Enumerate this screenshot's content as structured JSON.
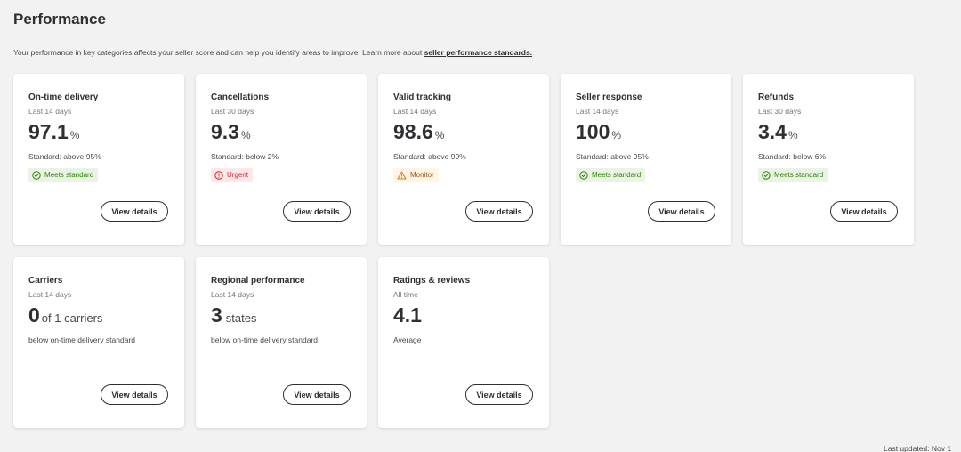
{
  "page": {
    "title": "Performance",
    "intro_text": "Your performance in key categories affects your seller score and can help you identify areas to improve. Learn more about ",
    "intro_link": "seller performance standards.",
    "last_updated": "Last updated: Nov 1"
  },
  "colors": {
    "good": "#2a8703",
    "urgent": "#de1c24",
    "monitor": "#995213"
  },
  "cards": [
    {
      "title": "On-time delivery",
      "period": "Last 14 days",
      "value": "97.1",
      "unit": "%",
      "standard": "Standard: above 95%",
      "badge": {
        "label": "Meets standard",
        "status": "good",
        "icon": "check-circle-icon"
      },
      "button": "View details"
    },
    {
      "title": "Cancellations",
      "period": "Last 30 days",
      "value": "9.3",
      "unit": "%",
      "standard": "Standard: below 2%",
      "badge": {
        "label": "Urgent",
        "status": "urgent",
        "icon": "alert-circle-icon"
      },
      "button": "View details"
    },
    {
      "title": "Valid tracking",
      "period": "Last 14 days",
      "value": "98.6",
      "unit": "%",
      "standard": "Standard: above 99%",
      "badge": {
        "label": "Monitor",
        "status": "monitor",
        "icon": "warning-triangle-icon"
      },
      "button": "View details"
    },
    {
      "title": "Seller response",
      "period": "Last 14 days",
      "value": "100",
      "unit": "%",
      "standard": "Standard: above 95%",
      "badge": {
        "label": "Meets standard",
        "status": "good",
        "icon": "check-circle-icon"
      },
      "button": "View details"
    },
    {
      "title": "Refunds",
      "period": "Last 30 days",
      "value": "3.4",
      "unit": "%",
      "standard": "Standard: below 6%",
      "badge": {
        "label": "Meets standard",
        "status": "good",
        "icon": "check-circle-icon"
      },
      "button": "View details"
    },
    {
      "title": "Carriers",
      "period": "Last 14 days",
      "value": "0",
      "unit": "of 1 carriers",
      "standard": "below on-time delivery standard",
      "button": "View details"
    },
    {
      "title": "Regional performance",
      "period": "Last 14 days",
      "value": "3",
      "unit": "states",
      "standard": "below on-time delivery standard",
      "button": "View details"
    },
    {
      "title": "Ratings & reviews",
      "period": "All time",
      "value": "4.1",
      "unit": "",
      "standard": "Average",
      "button": "View details"
    }
  ]
}
